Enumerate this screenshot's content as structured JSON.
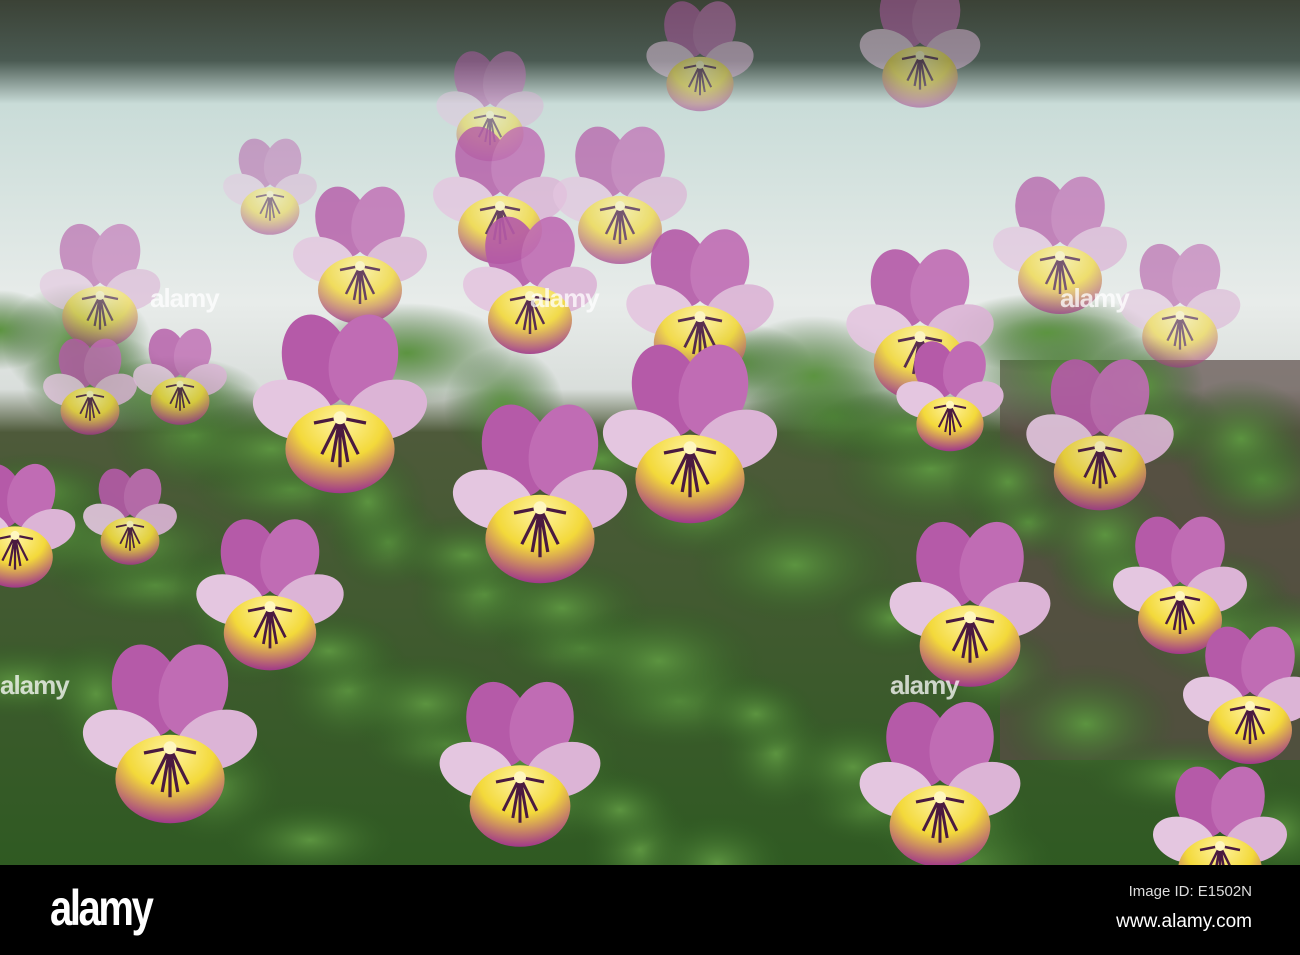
{
  "image": {
    "subject": "pansy-flowers"
  },
  "watermark": {
    "text": "alamy"
  },
  "footer": {
    "logo": "alamy",
    "image_id": "Image ID: E1502N",
    "website": "www.alamy.com"
  },
  "colors": {
    "petal_purple": "#b24fa3",
    "petal_light": "#e6c8e2",
    "petal_yellow": "#f3e04a",
    "foliage": "#3f7a2e"
  }
}
